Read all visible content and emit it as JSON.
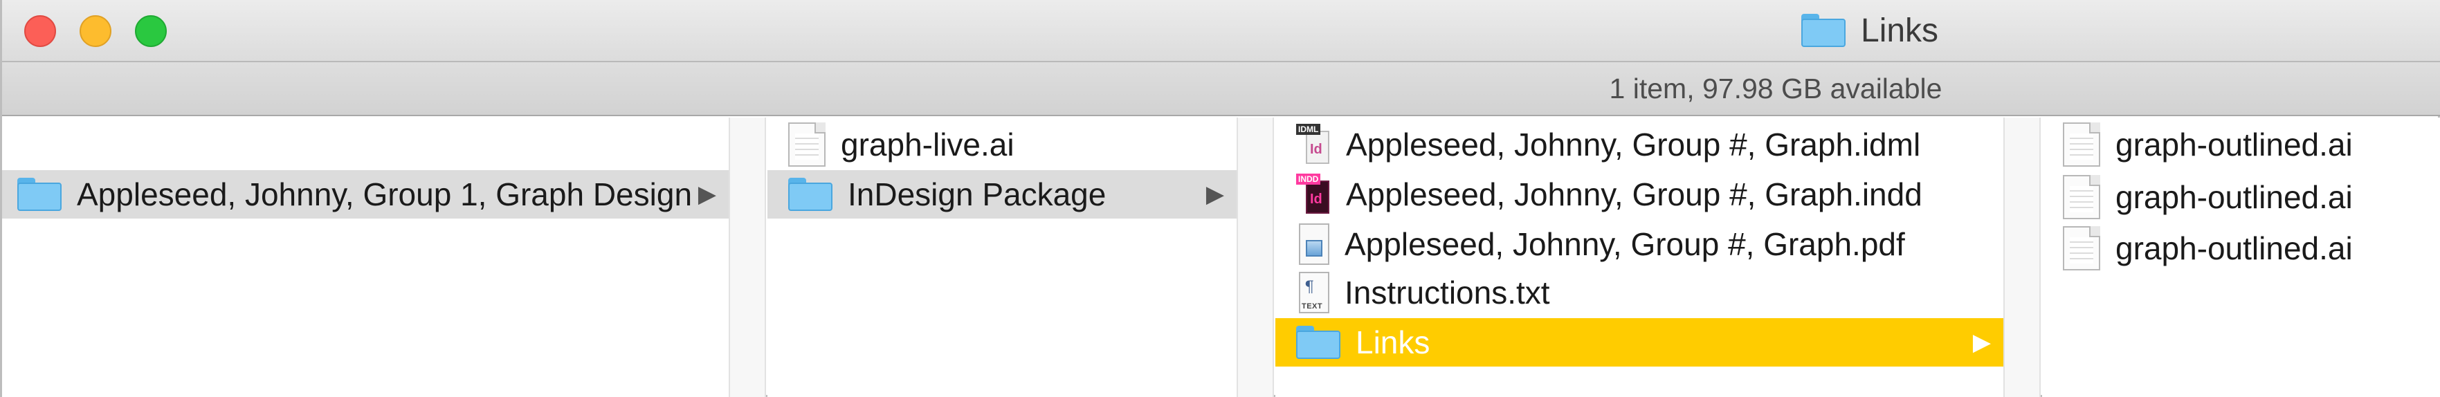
{
  "window": {
    "title": "Links",
    "title_icon": "folder-icon",
    "status": "1 item, 97.98 GB available"
  },
  "columns": [
    {
      "items": [
        {
          "label": "Appleseed, Johnny, Group 1, Graph Design",
          "icon": "folder-icon",
          "selected": "gray",
          "has_children": true
        }
      ]
    },
    {
      "items": [
        {
          "label": "graph-live.ai",
          "icon": "ai-document-icon"
        },
        {
          "label": "InDesign Package",
          "icon": "folder-icon",
          "selected": "gray",
          "has_children": true
        }
      ]
    },
    {
      "items": [
        {
          "label": "Appleseed, Johnny, Group #, Graph.idml",
          "icon": "idml-icon",
          "badge": "IDML",
          "glyph": "Id"
        },
        {
          "label": "Appleseed, Johnny, Group #, Graph.indd",
          "icon": "indd-icon",
          "badge": "INDD",
          "glyph": "Id"
        },
        {
          "label": "Appleseed, Johnny, Group #, Graph.pdf",
          "icon": "pdf-icon"
        },
        {
          "label": "Instructions.txt",
          "icon": "text-file-icon",
          "caption": "TEXT",
          "glyph": "¶"
        },
        {
          "label": "Links",
          "icon": "folder-icon",
          "selected": "yellow",
          "has_children": true
        }
      ]
    },
    {
      "items": [
        {
          "label": "graph-outlined.ai",
          "icon": "ai-document-icon"
        },
        {
          "label": "graph-outlined.ai",
          "icon": "ai-document-icon"
        },
        {
          "label": "graph-outlined.ai",
          "icon": "ai-document-icon"
        }
      ]
    }
  ],
  "arrow_glyph": "▶",
  "colors": {
    "selection_active": "#ffcc00",
    "selection_inactive": "#dcdcdc",
    "folder": "#7fcaf5"
  }
}
